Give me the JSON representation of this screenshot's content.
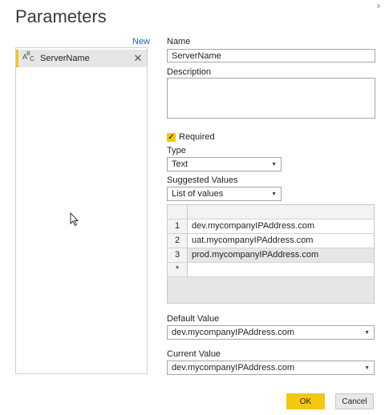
{
  "dialog": {
    "title": "Parameters",
    "close_glyph": "›"
  },
  "list": {
    "new_label": "New",
    "items": [
      {
        "name": "ServerName",
        "type_icon": "abc-text-type-icon",
        "remove_glyph": "✕"
      }
    ]
  },
  "form": {
    "name_label": "Name",
    "name_value": "ServerName",
    "description_label": "Description",
    "description_value": "",
    "required_label": "Required",
    "required_checked": true,
    "type_label": "Type",
    "type_value": "Text",
    "suggested_label": "Suggested Values",
    "suggested_value": "List of values",
    "values_grid": {
      "rows": [
        {
          "num": "1",
          "value": "dev.mycompanyIPAddress.com"
        },
        {
          "num": "2",
          "value": "uat.mycompanyIPAddress.com"
        },
        {
          "num": "3",
          "value": "prod.mycompanyIPAddress.com"
        },
        {
          "num": "*",
          "value": ""
        }
      ]
    },
    "default_label": "Default Value",
    "default_value": "dev.mycompanyIPAddress.com",
    "current_label": "Current Value",
    "current_value": "dev.mycompanyIPAddress.com"
  },
  "buttons": {
    "ok": "OK",
    "cancel": "Cancel"
  },
  "colors": {
    "accent": "#f2c811",
    "link": "#1866b4"
  }
}
